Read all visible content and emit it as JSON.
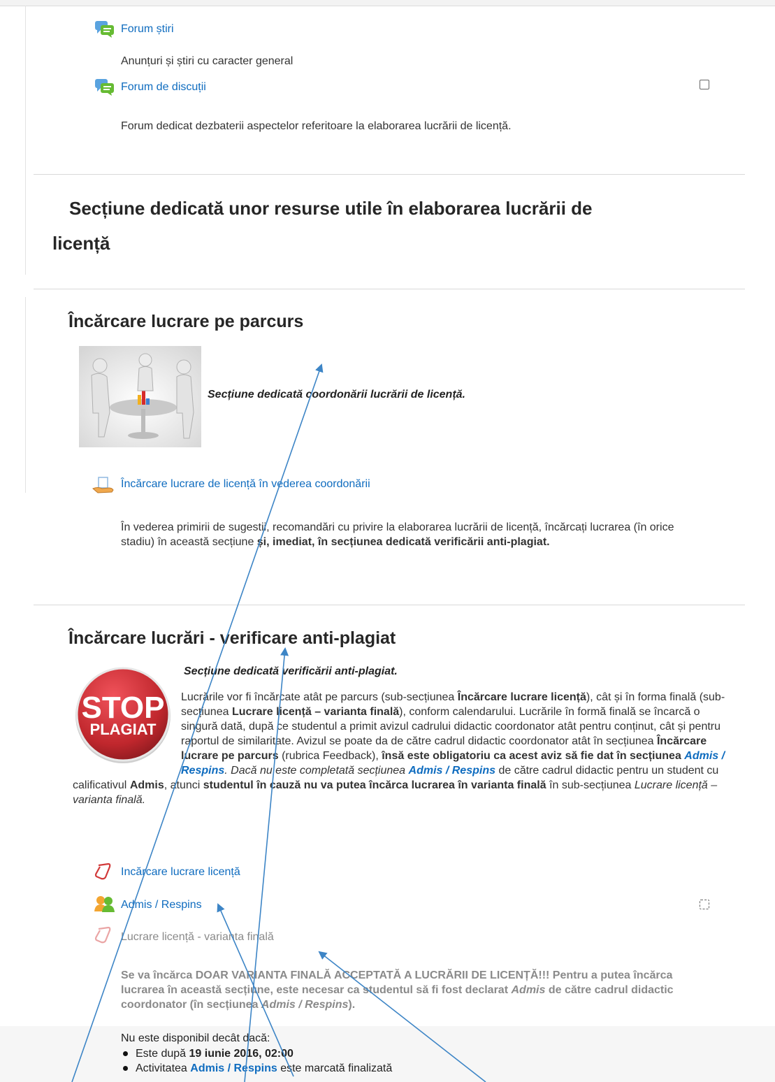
{
  "forum_news": {
    "label": "Forum știri",
    "description": "Anunțuri și știri cu caracter general"
  },
  "forum_discussion": {
    "label": "Forum de discuții",
    "description": "Forum dedicat dezbaterii aspectelor referitoare la elaborarea lucrării de licență."
  },
  "section_resources": {
    "title_line1": "Secțiune dedicată unor resurse utile în elaborarea lucrării de",
    "title_line2": "licență"
  },
  "section_upload": {
    "title": "Încărcare lucrare pe parcurs",
    "tagline": "Secțiune dedicată coordonării lucrării de licență.",
    "assignment_label": "Încărcare lucrare de licență în vederea coordonării",
    "desc_part1": "În vederea primirii de sugestii, recomandări cu privire la elaborarea lucrării de licență, încărcați lucrarea (în orice stadiu) în această secțiune ",
    "desc_part2": "și, imediat, în secțiunea dedicată verificării anti-plagiat."
  },
  "section_plagiarism": {
    "title": "Încărcare lucrări - verificare anti-plagiat",
    "tagline": "Secțiune dedicată verificării anti-plagiat.",
    "logo_text_top": "STOP",
    "logo_text_bottom": "PLAGIAT",
    "p1": "Lucrările vor fi încărcate atât pe parcurs (sub-secțiunea ",
    "p2": "Încărcare lucrare licență",
    "p3": "), cât și în forma finală (sub-secțiunea ",
    "p4": "Lucrare licență – varianta finală",
    "p5": "), conform calendarului. Lucrările în formă finală se încarcă o singură dată, după ce studentul a primit avizul cadrului didactic coordonator atât pentru conținut, cât și pentru raportul de similaritate. Avizul se poate da de către cadrul didactic coordonator atât în secțiunea ",
    "p6": "Încărcare lucrare pe parcurs",
    "p7": " (rubrica Feedback), ",
    "p8": "însă este obligatoriu ca acest aviz să fie dat în secțiunea ",
    "p9": "Admis / Respins",
    "p10": ". Dacă nu este completată secțiunea ",
    "p11": "Admis / Respins",
    "p12": " de către cadrul didactic pentru un student cu calificativul ",
    "p13": "Admis",
    "p14": ", atunci ",
    "p15": "studentul în cauză nu va putea încărca lucrarea în varianta finală",
    "p16": " în sub-secțiunea ",
    "p17": "Lucrare licență – varianta finală.",
    "activity_upload": "Incărcare lucrare licență",
    "activity_admis": "Admis / Respins",
    "activity_final": "Lucrare licență - varianta finală",
    "final_warn_1": "Se va încărca DOAR VARIANTA FINALĂ ACCEPTATĂ A LUCRĂRII DE LICENȚĂ!!! Pentru a putea încărca lucrarea în această secțiune, este necesar ca studentul să fi fost declarat ",
    "final_warn_admis": "Admis",
    "final_warn_2": " de către cadrul didactic coordonator (în secțiunea ",
    "final_warn_admis_respins": "Admis / Respins",
    "final_warn_3": ").",
    "restriction_intro": "Nu este disponibil decât dacă:",
    "restriction_1_prefix": "Este după ",
    "restriction_1_date": "19 iunie 2016, 02:00",
    "restriction_2_prefix": "Activitatea ",
    "restriction_2_link": "Admis / Respins",
    "restriction_2_suffix": " este marcată finalizată"
  },
  "colors": {
    "link": "#0f6cbf",
    "annotation_arrow": "#3d85c6",
    "stop_red": "#c0272d"
  }
}
